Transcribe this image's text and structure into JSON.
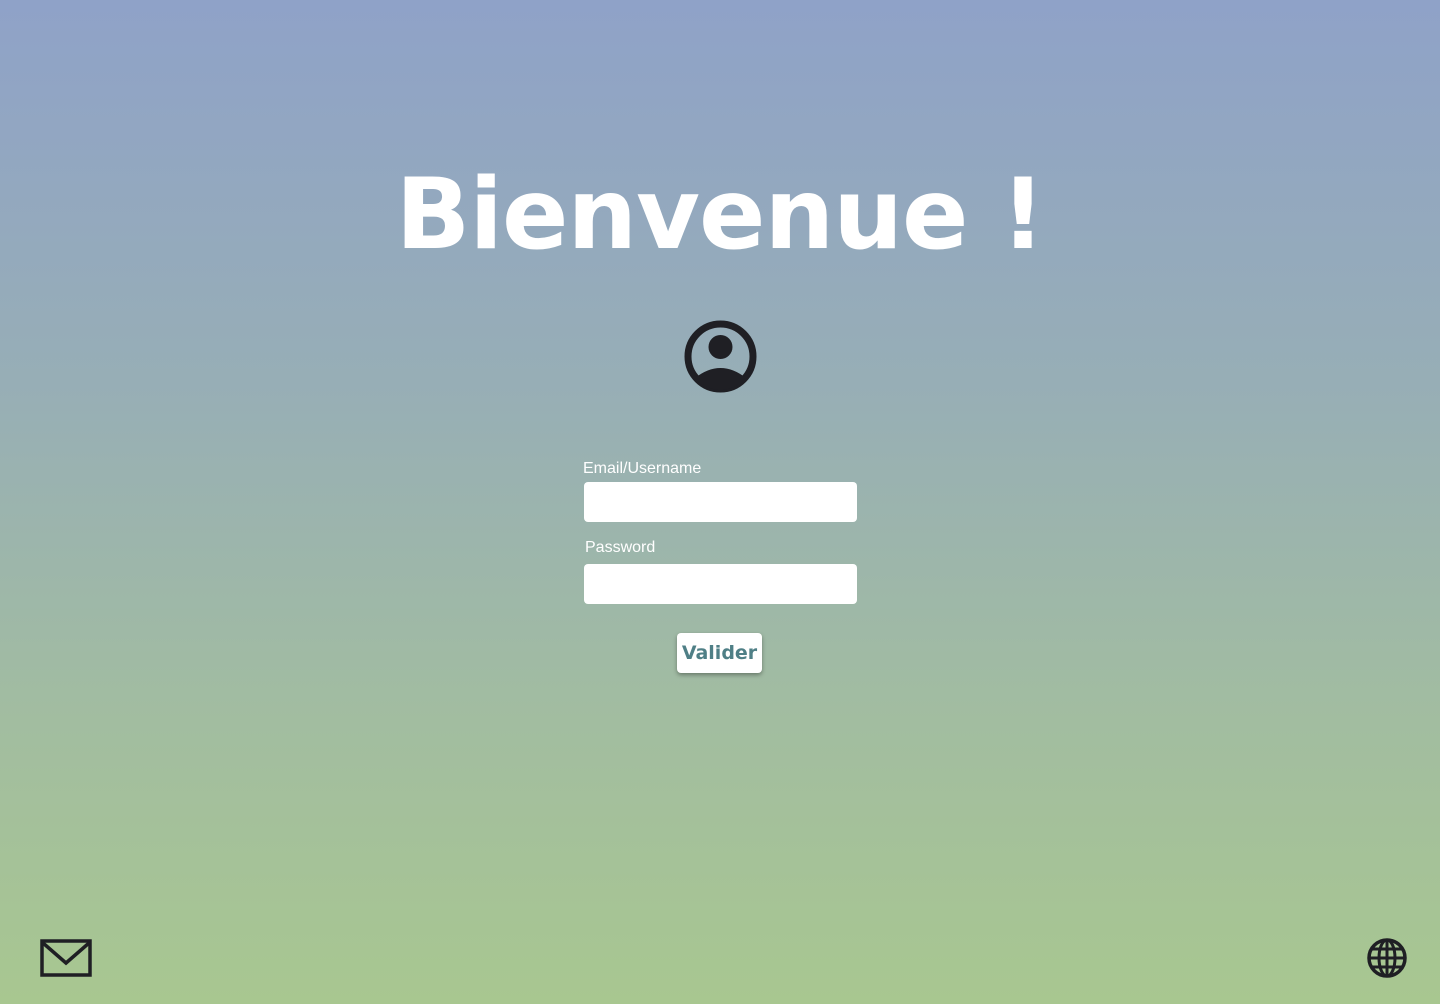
{
  "header": {
    "title": "Bienvenue !"
  },
  "avatar": {
    "icon": "user-circle-icon"
  },
  "form": {
    "email_label": "Email/Username",
    "email_value": "",
    "email_placeholder": "",
    "password_label": "Password",
    "password_value": "",
    "password_placeholder": "",
    "submit_label": "Valider"
  },
  "footer": {
    "mail_icon": "mail-icon",
    "language_icon": "globe-icon"
  },
  "colors": {
    "gradient_top": "#8fa2c8",
    "gradient_bottom": "#a8c790",
    "title": "#ffffff",
    "button_text": "#4f7f86",
    "icon": "#1f1f24"
  }
}
